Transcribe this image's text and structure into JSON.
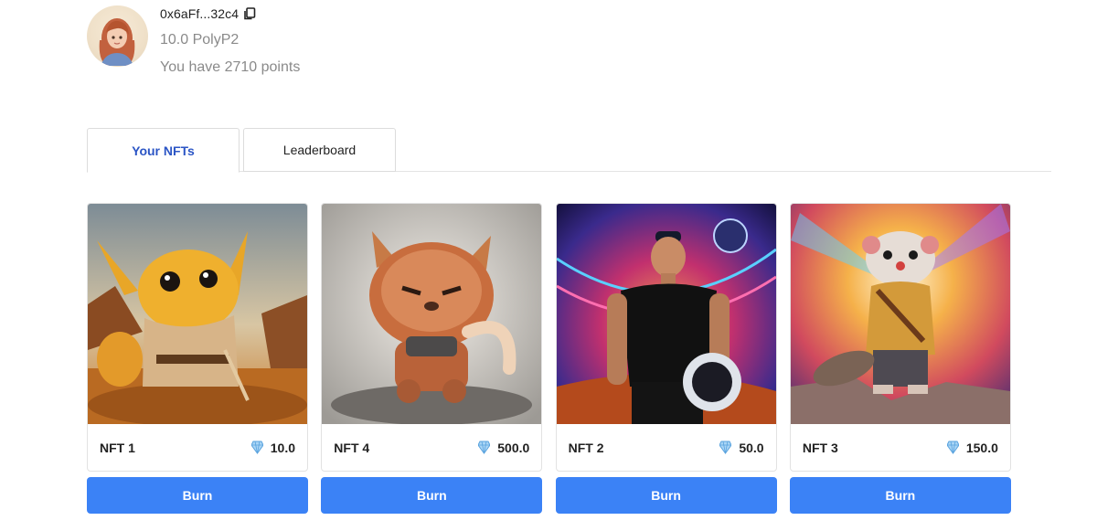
{
  "profile": {
    "address": "0x6aFf...32c4",
    "balance": "10.0 PolyP2",
    "points": "You have 2710 points"
  },
  "tabs": [
    {
      "label": "Your NFTs",
      "active": true
    },
    {
      "label": "Leaderboard",
      "active": false
    }
  ],
  "nfts": [
    {
      "name": "NFT 1",
      "price": "10.0",
      "art": "furry-desert-creature"
    },
    {
      "name": "NFT 4",
      "price": "500.0",
      "art": "fluffy-angry-creature"
    },
    {
      "name": "NFT 2",
      "price": "50.0",
      "art": "astronaut-man"
    },
    {
      "name": "NFT 3",
      "price": "150.0",
      "art": "mongoose-adventurer"
    }
  ],
  "burn_label": "Burn",
  "colors": {
    "accent": "#3b82f6",
    "tab_active": "#2b55c5",
    "muted_text": "#8a8a8a"
  },
  "icons": {
    "copy": "copy-icon",
    "price": "diamond-icon"
  }
}
